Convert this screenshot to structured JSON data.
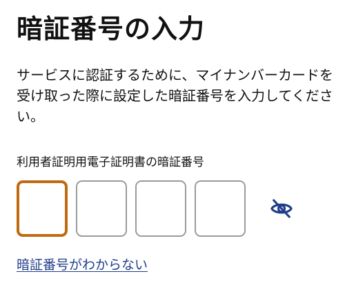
{
  "header": {
    "title": "暗証番号の入力"
  },
  "instructions": {
    "text": "サービスに認証するために、マイナンバーカードを受け取った際に設定した暗証番号を入力してください。"
  },
  "pin_input": {
    "label": "利用者証明用電子証明書の暗証番号",
    "digits": [
      "",
      "",
      "",
      ""
    ],
    "active_index": 0,
    "focus_color": "#c06a10",
    "border_color": "#9a9a9a",
    "visibility_toggle_icon": "eye-slash-icon"
  },
  "links": {
    "forgot_pin": "暗証番号がわからない",
    "color": "#1f3d8a"
  }
}
